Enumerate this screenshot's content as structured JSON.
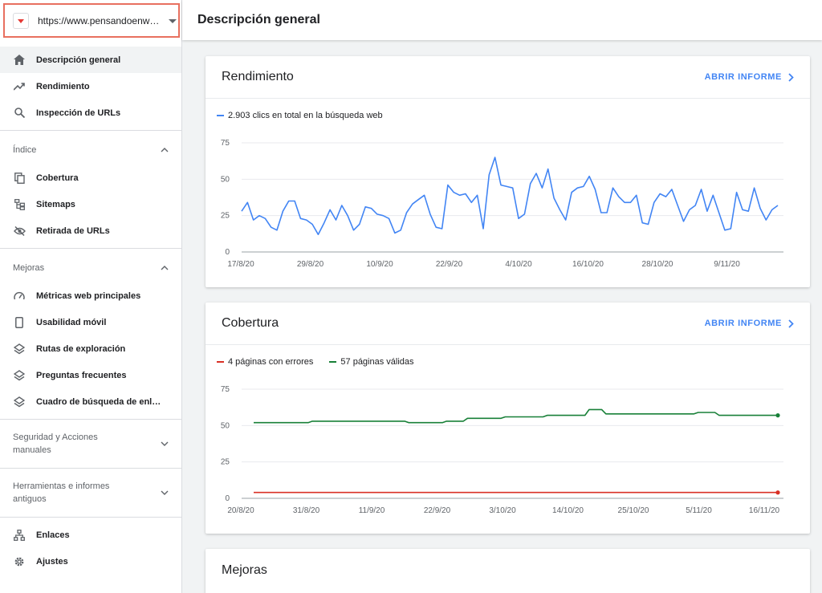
{
  "property": {
    "url": "https://www.pensandoenweb.es/"
  },
  "header": {
    "title": "Descripción general"
  },
  "sidebar": {
    "items_top": [
      {
        "label": "Descripción general",
        "icon": "home-icon",
        "active": true
      },
      {
        "label": "Rendimiento",
        "icon": "trending-up-icon"
      },
      {
        "label": "Inspección de URLs",
        "icon": "search-icon"
      }
    ],
    "sections": {
      "indice": {
        "label": "Índice",
        "items": [
          "Cobertura",
          "Sitemaps",
          "Retirada de URLs"
        ]
      },
      "mejoras": {
        "label": "Mejoras",
        "items": [
          "Métricas web principales",
          "Usabilidad móvil",
          "Rutas de exploración",
          "Preguntas frecuentes",
          "Cuadro de búsqueda de enlaces de sitio"
        ]
      },
      "seguridad": {
        "label": "Seguridad y Acciones manuales"
      },
      "herramientas": {
        "label": "Herramientas e informes antiguos"
      }
    },
    "items_bottom": [
      {
        "label": "Enlaces",
        "icon": "links-icon"
      },
      {
        "label": "Ajustes",
        "icon": "gear-icon"
      }
    ]
  },
  "cards": {
    "rendimiento": {
      "title": "Rendimiento",
      "open_label": "ABRIR INFORME",
      "legend": "2.903 clics en total en la búsqueda web"
    },
    "cobertura": {
      "title": "Cobertura",
      "open_label": "ABRIR INFORME",
      "legend_errors": "4 páginas con errores",
      "legend_valid": "57 páginas válidas"
    },
    "mejoras": {
      "title": "Mejoras"
    }
  },
  "colors": {
    "accent": "#4285f4",
    "error": "#d93025",
    "valid": "#188038",
    "highlight_border": "#e8705f"
  },
  "chart_data": [
    {
      "type": "line",
      "title": "",
      "ylim": [
        0,
        75
      ],
      "yticks": [
        0,
        25,
        50,
        75
      ],
      "xtick_labels": [
        "17/8/20",
        "29/8/20",
        "10/9/20",
        "22/9/20",
        "4/10/20",
        "16/10/20",
        "28/10/20",
        "9/11/20"
      ],
      "series": [
        {
          "name": "2.903 clics en total en la búsqueda web",
          "color": "#4285f4",
          "values": [
            28,
            34,
            22,
            25,
            23,
            17,
            15,
            28,
            35,
            35,
            23,
            22,
            19,
            12,
            20,
            29,
            22,
            32,
            25,
            15,
            19,
            31,
            30,
            26,
            25,
            23,
            13,
            15,
            27,
            33,
            36,
            39,
            26,
            17,
            16,
            46,
            41,
            39,
            40,
            34,
            39,
            16,
            53,
            65,
            46,
            45,
            44,
            23,
            26,
            47,
            54,
            44,
            57,
            37,
            29,
            22,
            41,
            44,
            45,
            52,
            43,
            27,
            27,
            44,
            38,
            34,
            34,
            39,
            20,
            19,
            34,
            40,
            38,
            43,
            32,
            21,
            29,
            32,
            43,
            28,
            39,
            27,
            15,
            16,
            41,
            29,
            28,
            44,
            30,
            22,
            29,
            32
          ]
        }
      ]
    },
    {
      "type": "line",
      "title": "",
      "ylim": [
        0,
        75
      ],
      "yticks": [
        0,
        25,
        50,
        75
      ],
      "xtick_labels": [
        "20/8/20",
        "31/8/20",
        "11/9/20",
        "22/9/20",
        "3/10/20",
        "14/10/20",
        "25/10/20",
        "5/11/20",
        "16/11/20"
      ],
      "series": [
        {
          "name": "4 páginas con errores",
          "color": "#d93025",
          "values": [
            4,
            4,
            4,
            4,
            4,
            4,
            4,
            4,
            4,
            4,
            4,
            4,
            4,
            4,
            4,
            4,
            4,
            4,
            4,
            4,
            4,
            4,
            4,
            4,
            4,
            4,
            4,
            4,
            4,
            4,
            4,
            4,
            4,
            4,
            4,
            4,
            4,
            4,
            4,
            4,
            4,
            4,
            4,
            4,
            4,
            4,
            4,
            4,
            4,
            4,
            4,
            4,
            4,
            4,
            4,
            4,
            4,
            4,
            4,
            4,
            4,
            4,
            4,
            4,
            4,
            4,
            4,
            4,
            4,
            4,
            4,
            4,
            4,
            4,
            4,
            4,
            4,
            4,
            4,
            4,
            4,
            4,
            4,
            4,
            4,
            4,
            4,
            4,
            4
          ]
        },
        {
          "name": "57 páginas válidas",
          "color": "#188038",
          "values": [
            52,
            52,
            52,
            52,
            52,
            52,
            52,
            52,
            52,
            52,
            52,
            52,
            52,
            52,
            53,
            53,
            53,
            53,
            53,
            53,
            53,
            53,
            53,
            53,
            53,
            53,
            53,
            53,
            53,
            53,
            53,
            53,
            53,
            53,
            53,
            53,
            53,
            52,
            52,
            52,
            52,
            52,
            52,
            52,
            52,
            52,
            53,
            53,
            53,
            53,
            53,
            55,
            55,
            55,
            55,
            55,
            55,
            55,
            55,
            55,
            56,
            56,
            56,
            56,
            56,
            56,
            56,
            56,
            56,
            56,
            57,
            57,
            57,
            57,
            57,
            57,
            57,
            57,
            57,
            57,
            61,
            61,
            61,
            61,
            58,
            58,
            58,
            58,
            58,
            58,
            58,
            58,
            58,
            58,
            58,
            58,
            58,
            58,
            58,
            58,
            58,
            58,
            58,
            58,
            58,
            58,
            59,
            59,
            59,
            59,
            59,
            57,
            57,
            57,
            57,
            57,
            57,
            57,
            57,
            57,
            57,
            57,
            57,
            57,
            57,
            57
          ]
        }
      ]
    }
  ]
}
